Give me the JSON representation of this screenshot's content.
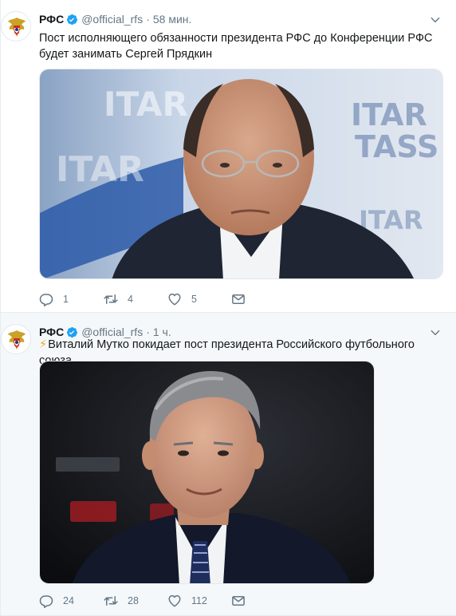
{
  "tweets": [
    {
      "author_name": "РФС",
      "handle": "@official_rfs",
      "separator": "·",
      "time": "58 мин.",
      "text": "Пост исполняющего обязанности президента РФС до Конференции РФС будет занимать Сергей Прядкин",
      "media_icon": "photo-press-conference",
      "reply_count": "1",
      "retweet_count": "4",
      "like_count": "5"
    },
    {
      "author_name": "РФС",
      "handle": "@official_rfs",
      "separator": "·",
      "time": "1 ч.",
      "emoji": "⚡",
      "text": "Виталий Мутко покидает пост президента Российского футбольного союза",
      "media_icon": "photo-portrait",
      "reply_count": "24",
      "retweet_count": "28",
      "like_count": "112"
    }
  ],
  "colors": {
    "accent": "#1da1f2",
    "text_secondary": "#657786",
    "divider": "#e6ecf0"
  }
}
